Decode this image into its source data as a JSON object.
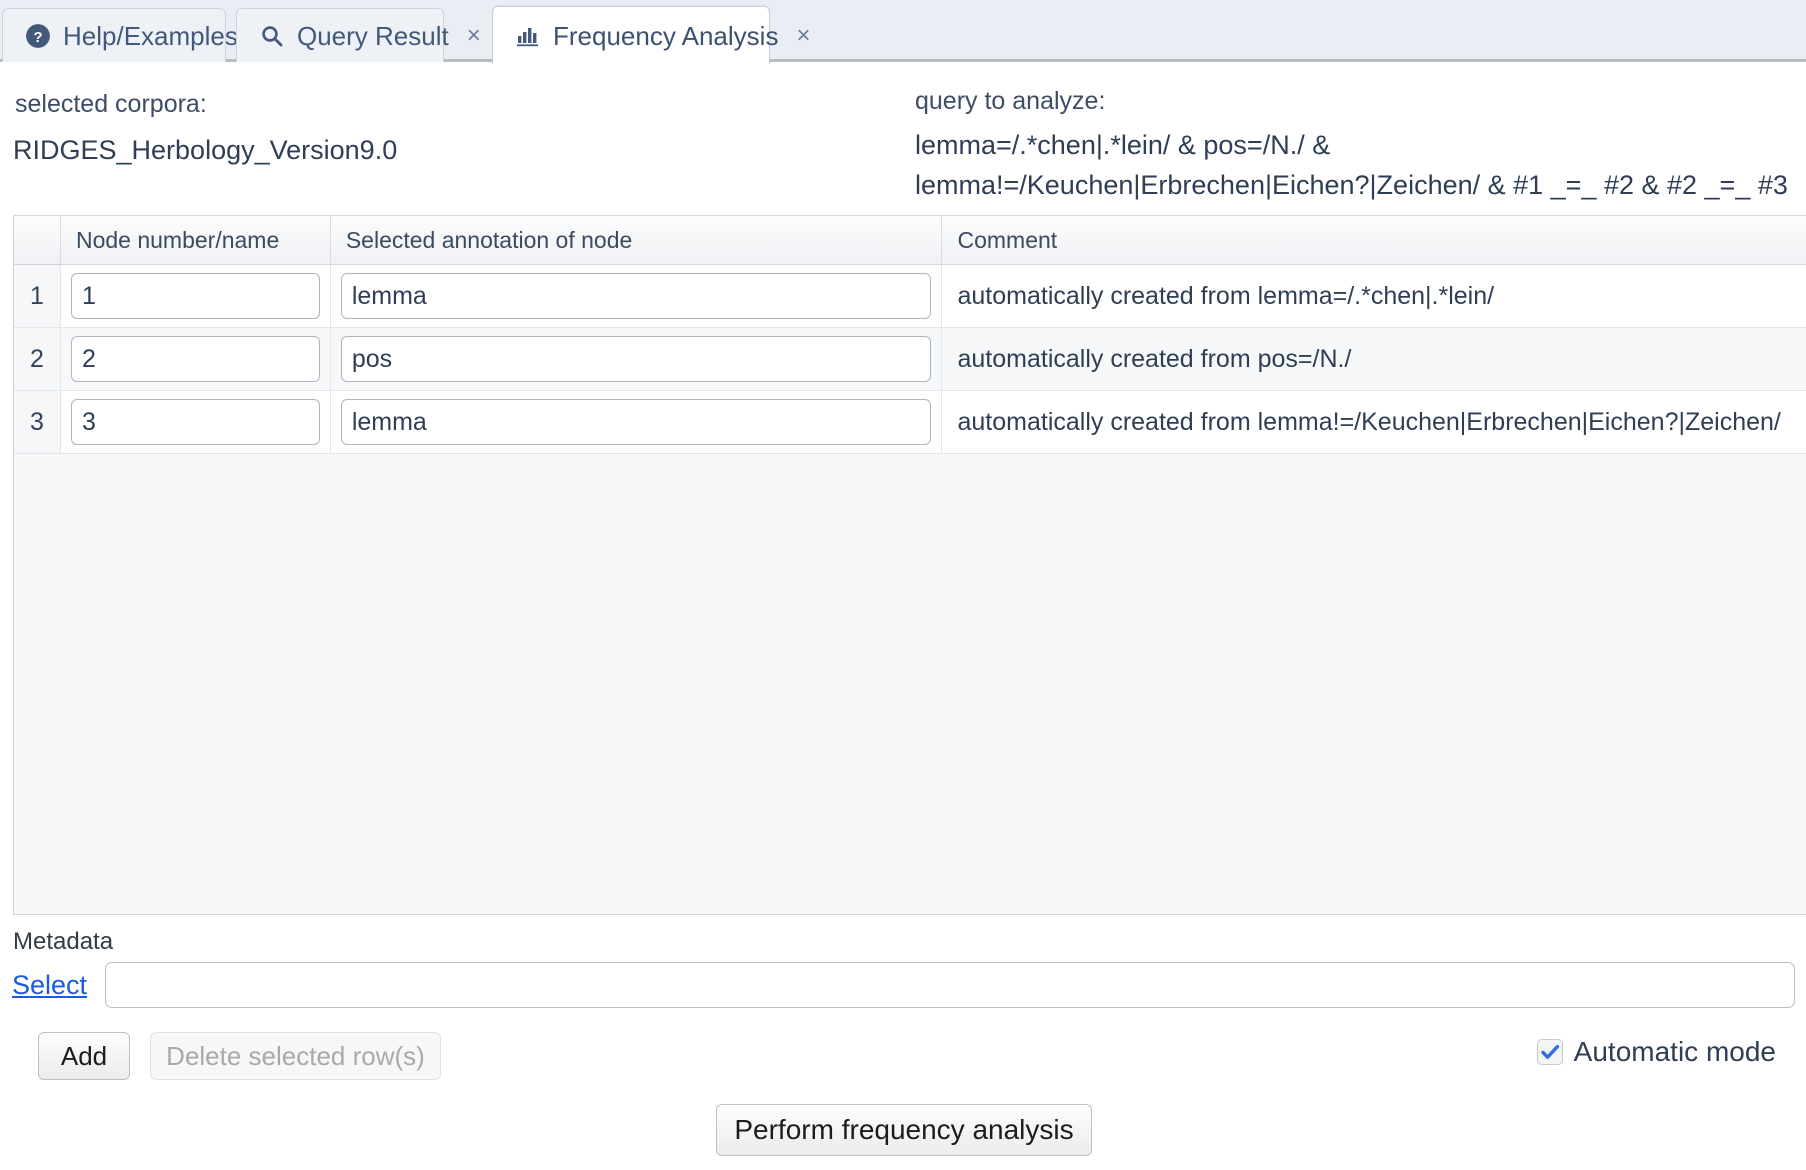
{
  "tabs": [
    {
      "label": "Help/Examples",
      "icon": "help-circle-icon",
      "closable": false,
      "selected": false
    },
    {
      "label": "Query Result",
      "icon": "search-icon",
      "closable": true,
      "selected": false
    },
    {
      "label": "Frequency Analysis",
      "icon": "bar-chart-icon",
      "closable": true,
      "selected": true
    }
  ],
  "close_glyph": "×",
  "info": {
    "corpora_label": "selected corpora:",
    "corpora_value": "RIDGES_Herbology_Version9.0",
    "query_label": "query to analyze:",
    "query_line_1": "lemma=/.*chen|.*lein/ & pos=/N./ &",
    "query_line_2": "lemma!=/Keuchen|Erbrechen|Eichen?|Zeichen/ & #1 _=_ #2 & #2 _=_ #3"
  },
  "grid": {
    "headers": [
      "",
      "Node number/name",
      "Selected annotation of node",
      "Comment"
    ],
    "rows": [
      {
        "index": "1",
        "node": "1",
        "annotation": "lemma",
        "comment": "automatically created from lemma=/.*chen|.*lein/"
      },
      {
        "index": "2",
        "node": "2",
        "annotation": "pos",
        "comment": "automatically created from pos=/N./"
      },
      {
        "index": "3",
        "node": "3",
        "annotation": "lemma",
        "comment": "automatically created from lemma!=/Keuchen|Erbrechen|Eichen?|Zeichen/"
      }
    ]
  },
  "metadata": {
    "label": "Metadata",
    "select_link": "Select",
    "input_value": "",
    "input_placeholder": ""
  },
  "actions": {
    "add_label": "Add",
    "delete_label": "Delete selected row(s)",
    "delete_enabled": false,
    "automatic_mode_label": "Automatic mode",
    "automatic_mode_checked": true,
    "perform_label": "Perform frequency analysis"
  },
  "colors": {
    "tab_text": "#44597a",
    "link": "#1a5ce0",
    "checkbox_accent": "#2f6fe0",
    "tabbar_bg": "#eaeef4"
  }
}
